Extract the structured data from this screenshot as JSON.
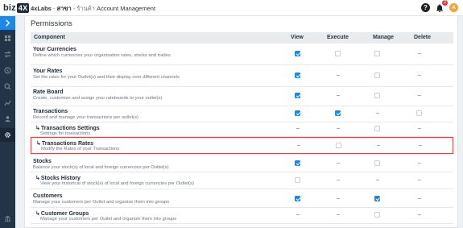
{
  "topbar": {
    "logo_text": "biz",
    "logo_box": "4X",
    "breadcrumb_org": "4xLabs",
    "breadcrumb_sep": "-",
    "breadcrumb_branch": "สาขา",
    "breadcrumb_shop": "- ร้านค้า",
    "breadcrumb_page": "Account Management",
    "help_label": "?",
    "notif_count": "2",
    "avatar_initial": "A"
  },
  "sidebar": {
    "items": [
      {
        "icon": "chevron-right-icon"
      },
      {
        "icon": "dashboard-icon"
      },
      {
        "icon": "exchange-icon"
      },
      {
        "icon": "money-icon"
      },
      {
        "icon": "search-icon"
      },
      {
        "icon": "chart-icon"
      },
      {
        "icon": "users-icon"
      },
      {
        "icon": "gear-icon"
      },
      {
        "icon": "bank-icon"
      }
    ]
  },
  "permissions": {
    "title": "Permissions",
    "headers": [
      "Component",
      "View",
      "Execute",
      "Manage",
      "Delete"
    ],
    "rows": [
      {
        "name": "Your Currencies",
        "desc": "Define which currencies your organisation rates, stocks and trades",
        "sub": false,
        "cells": [
          "on",
          "off",
          "off",
          "dash"
        ]
      },
      {
        "name": "Your Rates",
        "desc": "Set the rates for your Outlet(s) and their display over different channels",
        "sub": false,
        "cells": [
          "on",
          "dash",
          "off",
          "dash"
        ]
      },
      {
        "name": "Rate Board",
        "desc": "Create, customize and assign your rateboards to your outlet(s)",
        "sub": false,
        "cells": [
          "on",
          "dash",
          "off",
          "dash"
        ]
      },
      {
        "name": "Transactions",
        "desc": "Record and manage your transactions per outlet(s)",
        "sub": false,
        "cells": [
          "on",
          "on",
          "dash",
          "off"
        ]
      },
      {
        "name": "Transactions Settings",
        "desc": "Settings for transactions",
        "sub": true,
        "cells": [
          "dash",
          "dash",
          "off",
          "dash"
        ]
      },
      {
        "name": "Transactions Rates",
        "desc": "Modify the Rates of your Transactions",
        "sub": true,
        "cells": [
          "dash",
          "off",
          "dash",
          "dash"
        ]
      },
      {
        "name": "Stocks",
        "desc": "Balance your stock(s) of local and foreign currencies per Outlet(s)",
        "sub": false,
        "cells": [
          "on",
          "dash",
          "off",
          "dash"
        ]
      },
      {
        "name": "Stocks History",
        "desc": "View your historical of stock(s) of local and foreign currencies per Outlet(s)",
        "sub": true,
        "cells": [
          "off",
          "dash",
          "dash",
          "dash"
        ]
      },
      {
        "name": "Customers",
        "desc": "Manage your customers per Outlet and organize them into groups",
        "sub": false,
        "cells": [
          "on",
          "dash",
          "on",
          "dash"
        ]
      },
      {
        "name": "Customer Groups",
        "desc": "Manage your customers per Outlet and organize them into groups",
        "sub": true,
        "cells": [
          "dash",
          "dash",
          "off",
          "dash"
        ]
      }
    ]
  }
}
